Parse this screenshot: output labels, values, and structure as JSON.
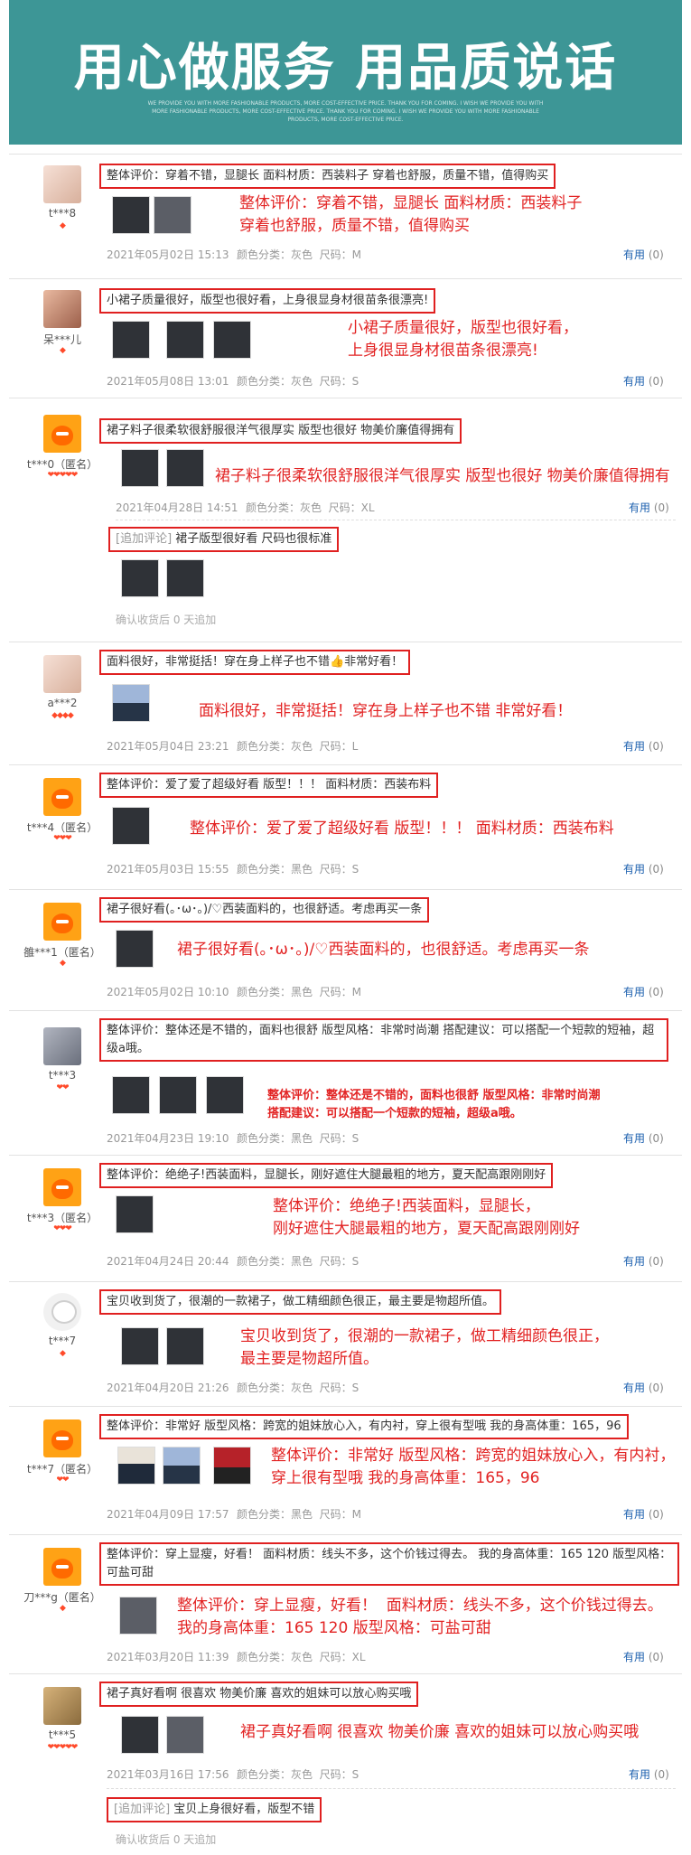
{
  "banner": {
    "title": "用心做服务 用品质说话",
    "subtitle": "WE PROVIDE YOU WITH MORE FASHIONABLE PRODUCTS, MORE COST-EFFECTIVE PRICE. THANK YOU FOR COMING. I WISH WE PROVIDE YOU WITH MORE FASHIONABLE PRODUCTS, MORE COST-EFFECTIVE PRICE. THANK YOU FOR COMING. I WISH WE PROVIDE YOU WITH MORE FASHIONABLE PRODUCTS, MORE COST-EFFECTIVE PRICE."
  },
  "useful_label": "有用",
  "reviews": [
    {
      "user": "t***8",
      "level": "◆",
      "text": "整体评价：穿着不错，显腿长 面料材质：西装料子 穿着也舒服，质量不错，值得购买",
      "red": "整体评价：穿着不错，显腿长 面料材质：西装料子\n穿着也舒服，质量不错，值得购买",
      "date": "2021年05月02日 15:13",
      "sku": "颜色分类：灰色  尺码：M",
      "count": "(0)"
    },
    {
      "user": "呆***儿",
      "level": "◆",
      "text": "小裙子质量很好，版型也很好看，上身很显身材很苗条很漂亮!",
      "red": "小裙子质量很好，版型也很好看，\n上身很显身材很苗条很漂亮!",
      "date": "2021年05月08日 13:01",
      "sku": "颜色分类：灰色  尺码：S",
      "count": "(0)"
    },
    {
      "user": "t***0（匿名）",
      "level": "❤❤❤❤❤",
      "text": "裙子料子很柔软很舒服很洋气很厚实 版型也很好 物美价廉值得拥有",
      "red": "裙子料子很柔软很舒服很洋气很厚实 版型也很好 物美价廉值得拥有",
      "date": "2021年04月28日 14:51",
      "sku": "颜色分类：灰色  尺码：XL",
      "count": "(0)",
      "append_tag": "[追加评论]",
      "append_text": "裙子版型很好看 尺码也很标准",
      "confirm": "确认收货后 0 天追加"
    },
    {
      "user": "a***2",
      "level": "◆◆◆◆",
      "text": "面料很好，非常挺括！穿在身上样子也不错👍非常好看！",
      "red": "面料很好，非常挺括！穿在身上样子也不错  非常好看！",
      "date": "2021年05月04日 23:21",
      "sku": "颜色分类：灰色  尺码：L",
      "count": "(0)"
    },
    {
      "user": "t***4（匿名）",
      "level": "❤❤❤",
      "text": "整体评价：爱了爱了超级好看 版型！！！ 面料材质：西装布料",
      "red": "整体评价：爱了爱了超级好看 版型！！！  面料材质：西装布料",
      "date": "2021年05月03日 15:55",
      "sku": "颜色分类：黑色  尺码：S",
      "count": "(0)"
    },
    {
      "user": "雒***1（匿名）",
      "level": "◆",
      "text": "裙子很好看(｡･ω･｡)/♡西装面料的，也很舒适。考虑再买一条",
      "red": "裙子很好看(｡･ω･｡)/♡西装面料的，也很舒适。考虑再买一条",
      "date": "2021年05月02日 10:10",
      "sku": "颜色分类：黑色  尺码：M",
      "count": "(0)"
    },
    {
      "user": "t***3",
      "level": "❤❤",
      "text": "整体评价：整体还是不错的，面料也很舒 版型风格：非常时尚潮 搭配建议：可以搭配一个短款的短袖，超级a哦。",
      "red": "整体评价：整体还是不错的，面料也很舒 版型风格：非常时尚潮\n搭配建议：可以搭配一个短款的短袖，超级a哦。",
      "date": "2021年04月23日 19:10",
      "sku": "颜色分类：黑色  尺码：S",
      "count": "(0)"
    },
    {
      "user": "t***3（匿名）",
      "level": "❤❤❤",
      "text": "整体评价：绝绝子!西装面料，显腿长，刚好遮住大腿最粗的地方，夏天配高跟刚刚好",
      "red": "整体评价：绝绝子!西装面料，显腿长，\n刚好遮住大腿最粗的地方，夏天配高跟刚刚好",
      "date": "2021年04月24日 20:44",
      "sku": "颜色分类：黑色  尺码：S",
      "count": "(0)"
    },
    {
      "user": "t***7",
      "level": "◆",
      "text": "宝贝收到货了，很潮的一款裙子，做工精细颜色很正，最主要是物超所值。",
      "red": "宝贝收到货了，很潮的一款裙子，做工精细颜色很正，\n最主要是物超所值。",
      "date": "2021年04月20日 21:26",
      "sku": "颜色分类：灰色  尺码：S",
      "count": "(0)"
    },
    {
      "user": "t***7（匿名）",
      "level": "❤❤",
      "text": "整体评价：非常好 版型风格：跨宽的姐妹放心入，有内衬，穿上很有型哦 我的身高体重：165，96",
      "red": "整体评价：非常好 版型风格：跨宽的姐妹放心入，有内衬，\n穿上很有型哦 我的身高体重：165，96",
      "date": "2021年04月09日 17:57",
      "sku": "颜色分类：黑色  尺码：M",
      "count": "(0)"
    },
    {
      "user": "刀***g（匿名）",
      "level": "◆",
      "text": "整体评价：穿上显瘦，好看！ 面料材质：线头不多，这个价钱过得去。 我的身高体重：165 120 版型风格：可盐可甜",
      "red": "整体评价：穿上显瘦，好看！  面料材质：线头不多，这个价钱过得去。\n我的身高体重：165 120 版型风格：可盐可甜",
      "date": "2021年03月20日 11:39",
      "sku": "颜色分类：灰色  尺码：XL",
      "count": "(0)"
    },
    {
      "user": "t***5",
      "level": "❤❤❤❤❤",
      "text": "裙子真好看啊 很喜欢 物美价廉 喜欢的姐妹可以放心购买哦",
      "red": "裙子真好看啊 很喜欢 物美价廉 喜欢的姐妹可以放心购买哦",
      "date": "2021年03月16日 17:56",
      "sku": "颜色分类：灰色  尺码：S",
      "count": "(0)",
      "append_tag": "[追加评论]",
      "append_text": "宝贝上身很好看，版型不错",
      "confirm": "确认收货后 0 天追加"
    }
  ]
}
